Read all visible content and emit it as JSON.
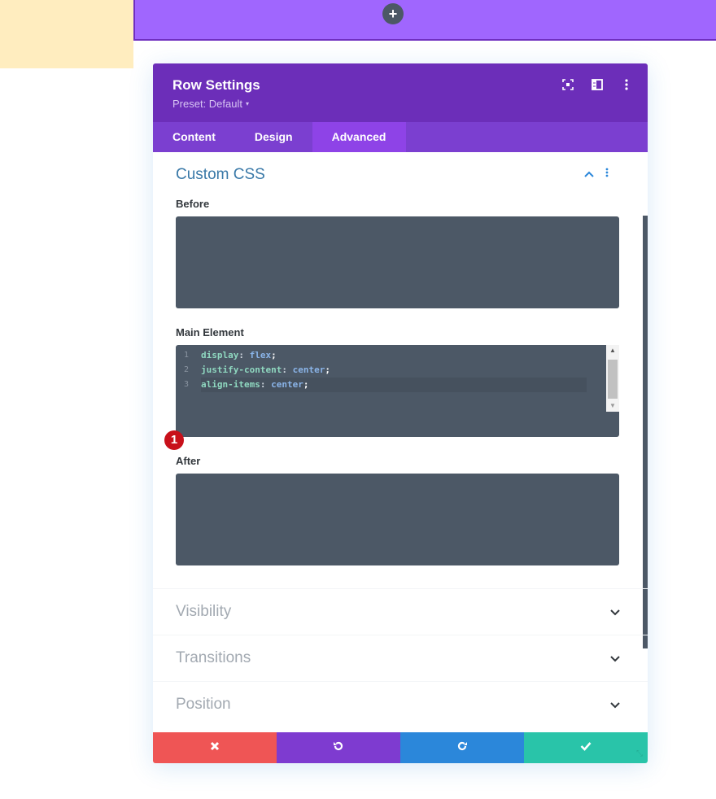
{
  "canvas": {
    "add_button_label": "+"
  },
  "modal": {
    "title": "Row Settings",
    "preset_label": "Preset: Default",
    "preset_caret": "▾",
    "header_icons": [
      "expand-icon",
      "sidebar-layout-icon",
      "more-vertical-icon"
    ],
    "tabs": [
      {
        "label": "Content",
        "active": false
      },
      {
        "label": "Design",
        "active": false
      },
      {
        "label": "Advanced",
        "active": true
      }
    ]
  },
  "custom_css": {
    "title": "Custom CSS",
    "expanded": true,
    "fields": {
      "before": {
        "label": "Before",
        "value": ""
      },
      "main": {
        "label": "Main Element",
        "line_numbers": [
          "1",
          "2",
          "3"
        ],
        "lines": [
          {
            "property": "display",
            "value": "flex"
          },
          {
            "property": "justify-content",
            "value": "center"
          },
          {
            "property": "align-items",
            "value": "center"
          }
        ]
      },
      "after": {
        "label": "After",
        "value": ""
      }
    },
    "annotation_badge": "1"
  },
  "sections": [
    {
      "title": "Visibility"
    },
    {
      "title": "Transitions"
    },
    {
      "title": "Position"
    }
  ],
  "footer": {
    "buttons": [
      "cancel",
      "undo",
      "redo",
      "save"
    ]
  },
  "colors": {
    "header_bg": "#6c2eb9",
    "tabs_bg": "#7b3fd0",
    "tab_active_bg": "#8e43e7",
    "canvas_row_bg": "#a066fe",
    "canvas_section_bg": "#ffedbf",
    "cancel": "#ef5555",
    "undo": "#7e3bd0",
    "redo": "#2b87da",
    "save": "#29c4a9",
    "badge": "#c8101a"
  }
}
